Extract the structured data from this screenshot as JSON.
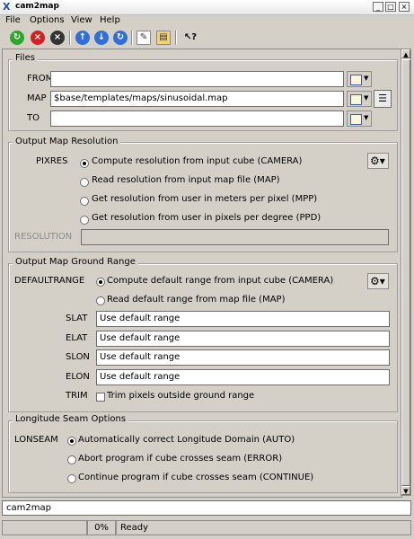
{
  "window": {
    "title": "cam2map",
    "min": "_",
    "max": "□",
    "close": "×"
  },
  "menu": {
    "file": "File",
    "options": "Options",
    "view": "View",
    "help": "Help"
  },
  "toolbar": {
    "run_glyph": "↻",
    "stop_glyph": "×",
    "exit_glyph": "×",
    "up_glyph": "↑",
    "down_glyph": "↓",
    "reset_glyph": "↻",
    "edit_glyph": "✎",
    "log_glyph": "▤",
    "whatsthis_glyph": "↖?"
  },
  "files": {
    "group_title": "Files",
    "from_label": "FROM",
    "from_value": "",
    "map_label": "MAP",
    "map_value": "$base/templates/maps/sinusoidal.map",
    "to_label": "TO",
    "to_value": "",
    "list_glyph": "☰"
  },
  "resolution": {
    "group_title": "Output Map Resolution",
    "pixres_label": "PIXRES",
    "options": [
      "Compute resolution from input cube (CAMERA)",
      "Read resolution from input map file (MAP)",
      "Get resolution from user in meters per pixel (MPP)",
      "Get resolution from user in pixels per degree (PPD)"
    ],
    "resolution_label": "RESOLUTION",
    "resolution_value": "",
    "gear_glyph": "⚙▾"
  },
  "ground": {
    "group_title": "Output Map Ground Range",
    "defaultrange_label": "DEFAULTRANGE",
    "options": [
      "Compute default range from input cube (CAMERA)",
      "Read default range from map file (MAP)"
    ],
    "slat_label": "SLAT",
    "slat_value": "Use default range",
    "elat_label": "ELAT",
    "elat_value": "Use default range",
    "slon_label": "SLON",
    "slon_value": "Use default range",
    "elon_label": "ELON",
    "elon_value": "Use default range",
    "trim_label": "TRIM",
    "trim_text": "Trim pixels outside ground range",
    "gear_glyph": "⚙▾"
  },
  "seam": {
    "group_title": "Longitude Seam Options",
    "lonseam_label": "LONSEAM",
    "options": [
      "Automatically correct Longitude Domain (AUTO)",
      "Abort program if cube crosses seam (ERROR)",
      "Continue program if cube crosses seam (CONTINUE)"
    ]
  },
  "scroll": {
    "up": "▲",
    "down": "▼"
  },
  "command_line": "cam2map",
  "status": {
    "progress": "0%",
    "state": "Ready"
  }
}
